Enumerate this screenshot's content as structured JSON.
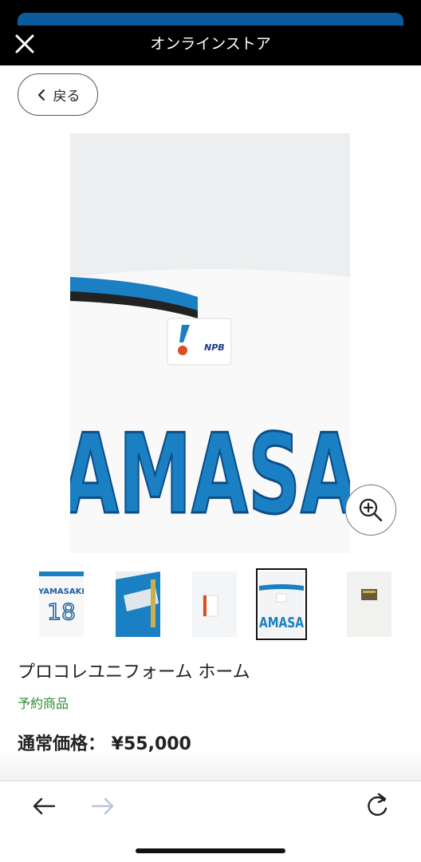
{
  "header": {
    "title": "オンラインストア"
  },
  "back_button": {
    "label": "戻る"
  },
  "main_image": {
    "lettering": "AMASA",
    "tag": "NPB"
  },
  "thumbnails": [
    {
      "name": "YAMASAKI",
      "number": "18"
    },
    {
      "name": ""
    },
    {
      "name": ""
    },
    {
      "name": "AMASA",
      "selected": true
    },
    {
      "name": ""
    }
  ],
  "product": {
    "title": "プロコレユニフォーム ホーム",
    "status": "予約商品",
    "price": "通常価格：  ¥55,000"
  },
  "colors": {
    "accent_blue": "#1b7fc4",
    "status_green": "#2e8b2e"
  }
}
